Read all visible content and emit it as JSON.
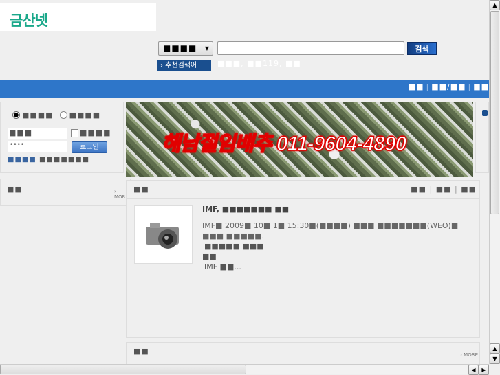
{
  "header": {
    "logo": "금산넷",
    "search_scope": "■■■■",
    "search_value": "",
    "search_button": "검색",
    "recommended_label": "› 추천검색어",
    "recommended_terms": "■■■, ■■119, ■■"
  },
  "nav": {
    "items": [
      "■■",
      "■■/■■",
      "■■"
    ]
  },
  "login": {
    "radio1": "■■■■",
    "radio2": "■■■■",
    "id_label": "■■■",
    "remember": "■■■■",
    "password": "••••",
    "login_button": "로그인",
    "link1": "■■■■",
    "link2": "■■■■■■■"
  },
  "banner": {
    "text": "해남절임배추 011-9604-4890"
  },
  "left_panel": {
    "title": "■■",
    "more": "› MORE"
  },
  "main_panel": {
    "title": "■■",
    "tabs": [
      "■■",
      "■■",
      "■■"
    ],
    "article_title": "IMF, ■■■■■■■ ■■",
    "article_body": "IMF■ 2009■ 10■ 1■ 15:30■(■■■■) ■■■ ■■■■■■■(WEO)■ ■■■ ■■■■■.",
    "line2": "■■■■■ ■■■",
    "line3": "■■",
    "line4": "IMF ■■..."
  },
  "bottom_panel": {
    "title": "■■",
    "more": "› MORE"
  }
}
